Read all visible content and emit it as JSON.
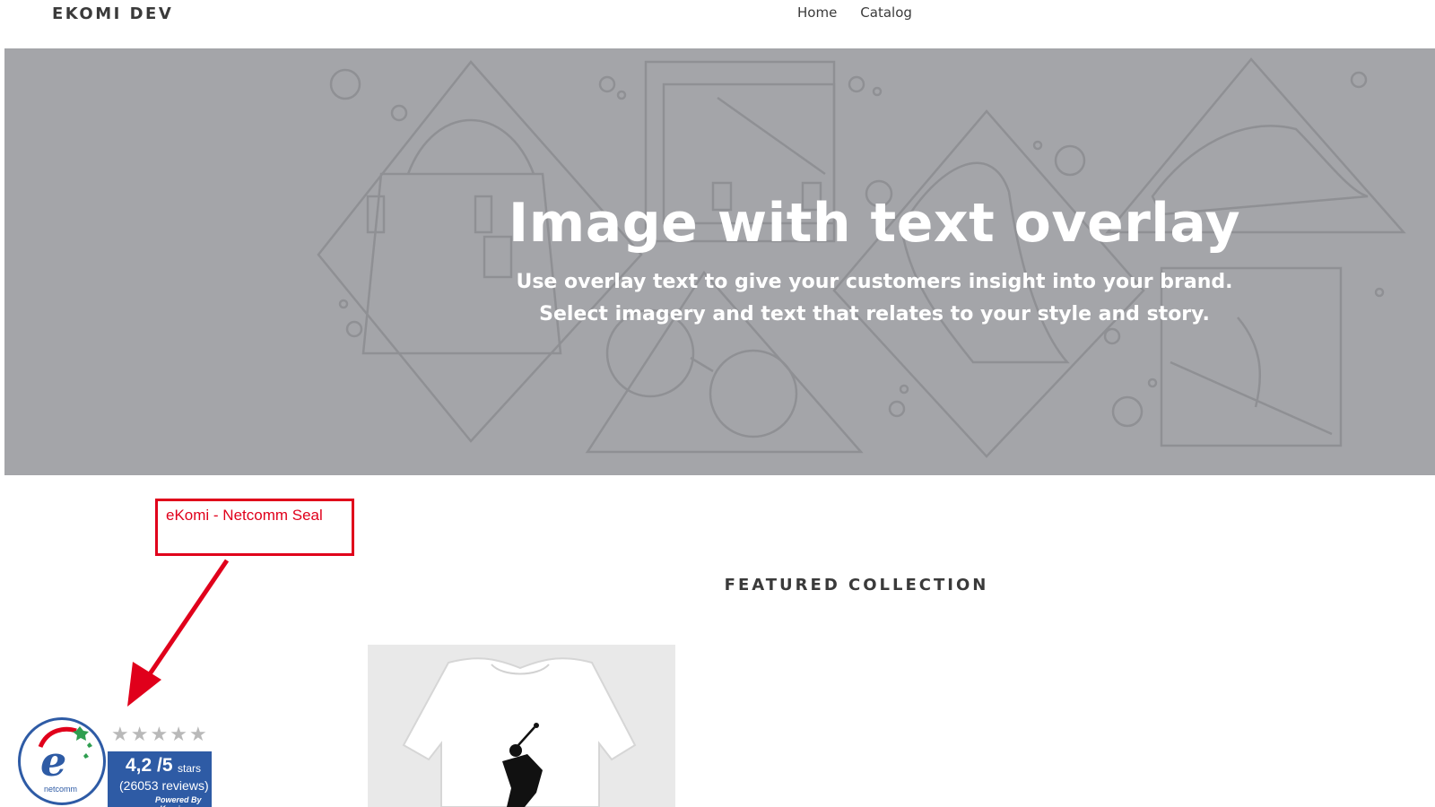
{
  "header": {
    "logo": "EKOMI DEV",
    "nav": [
      {
        "label": "Home"
      },
      {
        "label": "Catalog"
      }
    ]
  },
  "hero": {
    "title": "Image with text overlay",
    "subtitle_line1": "Use overlay text to give your customers insight into your brand.",
    "subtitle_line2": "Select imagery and text that relates to your style and story.",
    "background_color": "#a4a5a9",
    "line_color": "#8f9094"
  },
  "annotation": {
    "label": "eKomi - Netcomm Seal",
    "color": "#e0001b"
  },
  "featured": {
    "title": "FEATURED COLLECTION"
  },
  "seal": {
    "rating": "4,2 /5",
    "stars_word": "stars",
    "reviews": "(26053 reviews)",
    "powered": "Powered By eKomi",
    "brand": "netcomm",
    "panel_color": "#2e5ba5",
    "star_count": 5
  }
}
